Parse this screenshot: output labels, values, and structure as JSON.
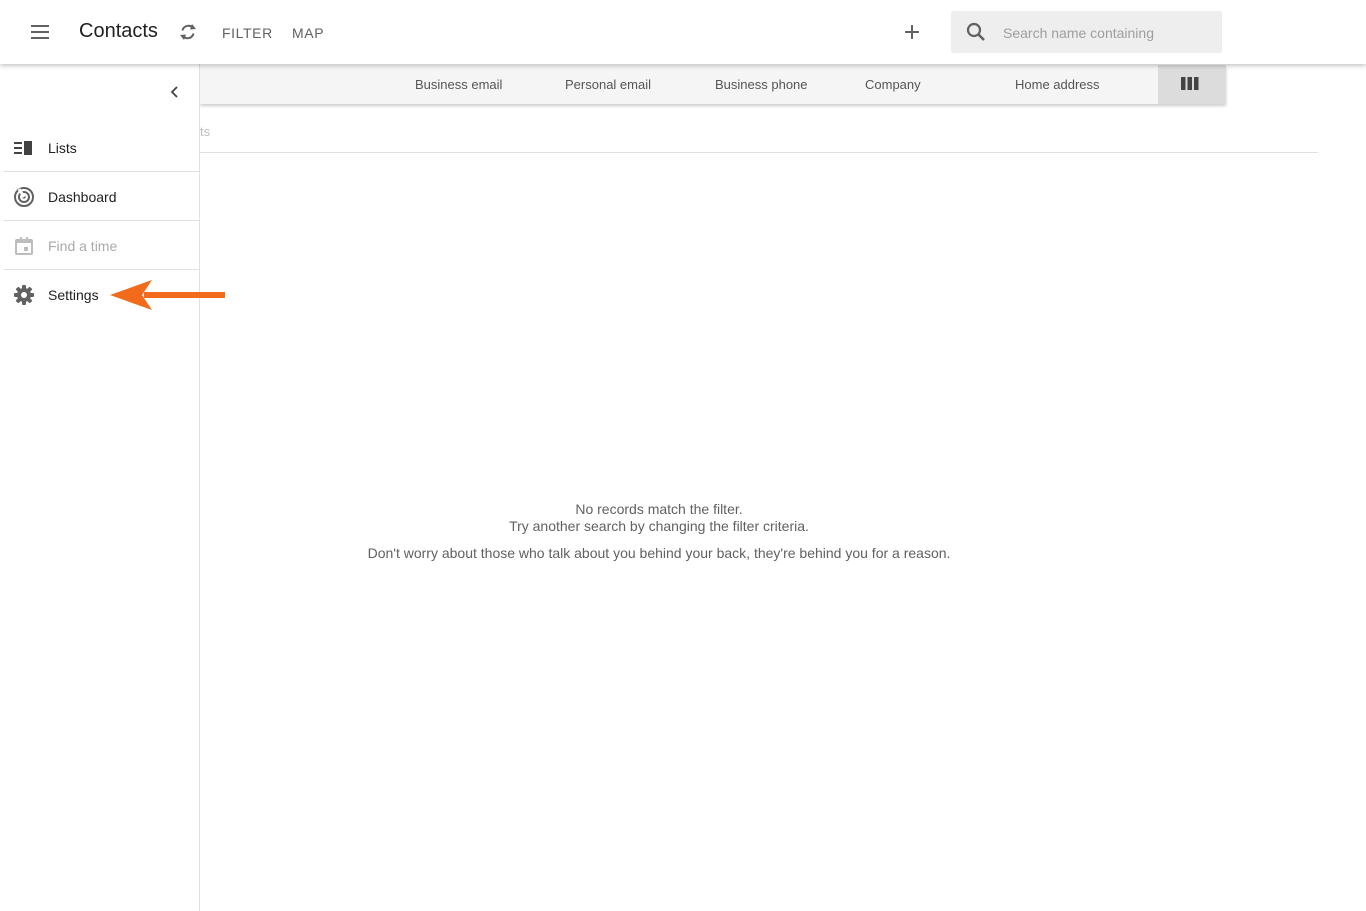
{
  "appbar": {
    "title": "Contacts",
    "nav": {
      "filter": "FILTER",
      "map": "MAP"
    },
    "search_placeholder": "Search name containing"
  },
  "columns": [
    "Business email",
    "Personal email",
    "Business phone",
    "Company",
    "Home address"
  ],
  "content": {
    "partial_tab_text": "ts",
    "empty_line1": "No records match the filter.",
    "empty_line2": "Try another search by changing the filter criteria.",
    "quote": "Don't worry about those who talk about you behind your back, they're behind you for a reason."
  },
  "drawer": {
    "items": [
      {
        "label": "Lists",
        "icon": "lists-icon"
      },
      {
        "label": "Dashboard",
        "icon": "dashboard-icon"
      },
      {
        "label": "Find a time",
        "icon": "calendar-icon",
        "disabled": true
      },
      {
        "label": "Settings",
        "icon": "gear-icon"
      }
    ]
  },
  "colors": {
    "annotation_arrow": "#f26a1b",
    "search_bg": "#eeeeee",
    "column_bar_bg": "#f5f5f5",
    "column_toggle_bg": "#dcdcdc"
  }
}
